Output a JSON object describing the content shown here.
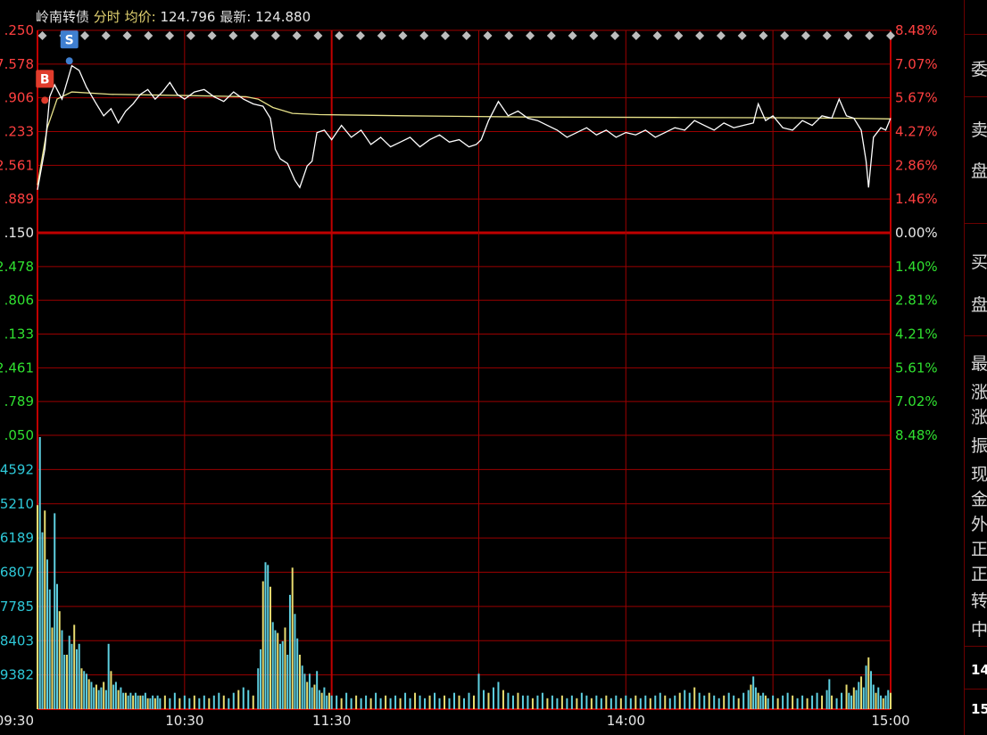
{
  "header": {
    "name": "岭南转债",
    "mode": "分时",
    "avg_label": "均价:",
    "avg_value": "124.796",
    "last_label": "最新:",
    "last_value": "124.880"
  },
  "colors": {
    "grid": "#9b0000",
    "price_line": "#ffffff",
    "avg_line": "#e8e28a",
    "up": "#ff3030",
    "down": "#30e030",
    "volume_axis": "#2ec8d8",
    "volume_bar_yellow": "#e8dc70",
    "volume_bar_cyan": "#5ecfe0"
  },
  "chart_data": {
    "type": "line",
    "left_ticks_price": [
      ".250",
      "7.578",
      ".906",
      ".233",
      "2.561",
      ".889",
      ".150",
      "2.478",
      ".806",
      ".133",
      "2.461",
      ".789",
      ".050"
    ],
    "right_ticks_pct": [
      "8.48%",
      "7.07%",
      "5.67%",
      "4.27%",
      "2.86%",
      "1.46%",
      "0.00%",
      "1.40%",
      "2.81%",
      "4.21%",
      "5.61%",
      "7.02%",
      "8.48%"
    ],
    "volume_ticks": [
      "4592",
      "5210",
      "6189",
      "6807",
      "7785",
      "8403",
      "9382"
    ],
    "time_labels": [
      "09:30",
      "10:30",
      "11:30",
      "14:00",
      "15:00"
    ],
    "y_range_pct": [
      -8.48,
      8.48
    ],
    "price_pct": [
      [
        0,
        1.8
      ],
      [
        3,
        3.5
      ],
      [
        5,
        5.7
      ],
      [
        7,
        6.2
      ],
      [
        10,
        5.6
      ],
      [
        14,
        7.0
      ],
      [
        17,
        6.8
      ],
      [
        20,
        6.1
      ],
      [
        24,
        5.4
      ],
      [
        27,
        4.9
      ],
      [
        30,
        5.2
      ],
      [
        33,
        4.6
      ],
      [
        36,
        5.1
      ],
      [
        39,
        5.4
      ],
      [
        42,
        5.8
      ],
      [
        45,
        6.0
      ],
      [
        48,
        5.6
      ],
      [
        51,
        5.9
      ],
      [
        54,
        6.3
      ],
      [
        57,
        5.8
      ],
      [
        60,
        5.6
      ],
      [
        64,
        5.9
      ],
      [
        68,
        6.0
      ],
      [
        72,
        5.7
      ],
      [
        76,
        5.5
      ],
      [
        80,
        5.9
      ],
      [
        84,
        5.6
      ],
      [
        88,
        5.4
      ],
      [
        92,
        5.3
      ],
      [
        95,
        4.8
      ],
      [
        97,
        3.5
      ],
      [
        99,
        3.1
      ],
      [
        102,
        2.9
      ],
      [
        105,
        2.2
      ],
      [
        107,
        1.9
      ],
      [
        110,
        2.8
      ],
      [
        112,
        3.0
      ],
      [
        114,
        4.2
      ],
      [
        117,
        4.3
      ],
      [
        120,
        3.9
      ],
      [
        124,
        4.5
      ],
      [
        128,
        4.0
      ],
      [
        132,
        4.3
      ],
      [
        136,
        3.7
      ],
      [
        140,
        4.0
      ],
      [
        144,
        3.6
      ],
      [
        148,
        3.8
      ],
      [
        152,
        4.0
      ],
      [
        156,
        3.6
      ],
      [
        160,
        3.9
      ],
      [
        164,
        4.1
      ],
      [
        168,
        3.8
      ],
      [
        172,
        3.9
      ],
      [
        176,
        3.6
      ],
      [
        179,
        3.7
      ],
      [
        181,
        3.9
      ],
      [
        184,
        4.7
      ],
      [
        188,
        5.5
      ],
      [
        192,
        4.9
      ],
      [
        196,
        5.1
      ],
      [
        200,
        4.8
      ],
      [
        204,
        4.7
      ],
      [
        208,
        4.5
      ],
      [
        212,
        4.3
      ],
      [
        216,
        4.0
      ],
      [
        220,
        4.2
      ],
      [
        224,
        4.4
      ],
      [
        228,
        4.1
      ],
      [
        232,
        4.3
      ],
      [
        236,
        4.0
      ],
      [
        240,
        4.2
      ],
      [
        244,
        4.1
      ],
      [
        248,
        4.3
      ],
      [
        252,
        4.0
      ],
      [
        256,
        4.2
      ],
      [
        260,
        4.4
      ],
      [
        264,
        4.3
      ],
      [
        268,
        4.7
      ],
      [
        272,
        4.5
      ],
      [
        276,
        4.3
      ],
      [
        280,
        4.6
      ],
      [
        284,
        4.4
      ],
      [
        288,
        4.5
      ],
      [
        292,
        4.6
      ],
      [
        294,
        5.4
      ],
      [
        297,
        4.7
      ],
      [
        300,
        4.9
      ],
      [
        304,
        4.4
      ],
      [
        308,
        4.3
      ],
      [
        312,
        4.7
      ],
      [
        316,
        4.5
      ],
      [
        320,
        4.9
      ],
      [
        324,
        4.8
      ],
      [
        327,
        5.6
      ],
      [
        330,
        4.9
      ],
      [
        333,
        4.8
      ],
      [
        336,
        4.3
      ],
      [
        338,
        3.0
      ],
      [
        339,
        1.9
      ],
      [
        341,
        4.0
      ],
      [
        344,
        4.4
      ],
      [
        346,
        4.3
      ],
      [
        348,
        4.8
      ]
    ],
    "avg_pct": [
      [
        0,
        2.0
      ],
      [
        4,
        4.4
      ],
      [
        8,
        5.6
      ],
      [
        14,
        5.9
      ],
      [
        30,
        5.8
      ],
      [
        60,
        5.75
      ],
      [
        85,
        5.7
      ],
      [
        90,
        5.6
      ],
      [
        96,
        5.25
      ],
      [
        104,
        5.0
      ],
      [
        115,
        4.95
      ],
      [
        150,
        4.9
      ],
      [
        200,
        4.85
      ],
      [
        260,
        4.83
      ],
      [
        300,
        4.82
      ],
      [
        330,
        4.8
      ],
      [
        348,
        4.77
      ]
    ],
    "volume": [
      [
        0,
        0.75
      ],
      [
        1,
        1.0
      ],
      [
        2,
        0.65
      ],
      [
        3,
        0.73
      ],
      [
        4,
        0.55
      ],
      [
        5,
        0.44
      ],
      [
        6,
        0.3
      ],
      [
        7,
        0.72
      ],
      [
        8,
        0.46
      ],
      [
        9,
        0.36
      ],
      [
        10,
        0.29
      ],
      [
        11,
        0.2
      ],
      [
        12,
        0.2
      ],
      [
        13,
        0.27
      ],
      [
        14,
        0.24
      ],
      [
        15,
        0.31
      ],
      [
        16,
        0.22
      ],
      [
        17,
        0.24
      ],
      [
        18,
        0.15
      ],
      [
        19,
        0.14
      ],
      [
        20,
        0.13
      ],
      [
        21,
        0.11
      ],
      [
        22,
        0.1
      ],
      [
        23,
        0.08
      ],
      [
        24,
        0.09
      ],
      [
        25,
        0.07
      ],
      [
        26,
        0.08
      ],
      [
        27,
        0.1
      ],
      [
        28,
        0.07
      ],
      [
        29,
        0.24
      ],
      [
        30,
        0.14
      ],
      [
        31,
        0.09
      ],
      [
        32,
        0.1
      ],
      [
        33,
        0.07
      ],
      [
        34,
        0.08
      ],
      [
        35,
        0.06
      ],
      [
        36,
        0.06
      ],
      [
        37,
        0.05
      ],
      [
        38,
        0.06
      ],
      [
        39,
        0.05
      ],
      [
        40,
        0.06
      ],
      [
        41,
        0.05
      ],
      [
        42,
        0.05
      ],
      [
        43,
        0.05
      ],
      [
        44,
        0.06
      ],
      [
        45,
        0.04
      ],
      [
        46,
        0.04
      ],
      [
        47,
        0.05
      ],
      [
        48,
        0.04
      ],
      [
        49,
        0.05
      ],
      [
        50,
        0.04
      ],
      [
        52,
        0.05
      ],
      [
        54,
        0.04
      ],
      [
        56,
        0.06
      ],
      [
        58,
        0.04
      ],
      [
        60,
        0.05
      ],
      [
        62,
        0.04
      ],
      [
        64,
        0.05
      ],
      [
        66,
        0.04
      ],
      [
        68,
        0.05
      ],
      [
        70,
        0.04
      ],
      [
        72,
        0.05
      ],
      [
        74,
        0.06
      ],
      [
        76,
        0.05
      ],
      [
        78,
        0.04
      ],
      [
        80,
        0.06
      ],
      [
        82,
        0.07
      ],
      [
        84,
        0.08
      ],
      [
        86,
        0.07
      ],
      [
        88,
        0.05
      ],
      [
        90,
        0.15
      ],
      [
        91,
        0.22
      ],
      [
        92,
        0.47
      ],
      [
        93,
        0.54
      ],
      [
        94,
        0.53
      ],
      [
        95,
        0.45
      ],
      [
        96,
        0.32
      ],
      [
        97,
        0.29
      ],
      [
        98,
        0.28
      ],
      [
        99,
        0.24
      ],
      [
        100,
        0.25
      ],
      [
        101,
        0.3
      ],
      [
        102,
        0.2
      ],
      [
        103,
        0.42
      ],
      [
        104,
        0.52
      ],
      [
        105,
        0.35
      ],
      [
        106,
        0.26
      ],
      [
        107,
        0.2
      ],
      [
        108,
        0.16
      ],
      [
        109,
        0.13
      ],
      [
        110,
        0.1
      ],
      [
        111,
        0.13
      ],
      [
        112,
        0.08
      ],
      [
        113,
        0.09
      ],
      [
        114,
        0.14
      ],
      [
        115,
        0.07
      ],
      [
        116,
        0.06
      ],
      [
        117,
        0.08
      ],
      [
        118,
        0.05
      ],
      [
        119,
        0.06
      ],
      [
        120,
        0.05
      ],
      [
        122,
        0.05
      ],
      [
        124,
        0.04
      ],
      [
        126,
        0.06
      ],
      [
        128,
        0.04
      ],
      [
        130,
        0.05
      ],
      [
        132,
        0.04
      ],
      [
        134,
        0.05
      ],
      [
        136,
        0.04
      ],
      [
        138,
        0.06
      ],
      [
        140,
        0.04
      ],
      [
        142,
        0.05
      ],
      [
        144,
        0.04
      ],
      [
        146,
        0.05
      ],
      [
        148,
        0.04
      ],
      [
        150,
        0.06
      ],
      [
        152,
        0.04
      ],
      [
        154,
        0.06
      ],
      [
        156,
        0.05
      ],
      [
        158,
        0.04
      ],
      [
        160,
        0.05
      ],
      [
        162,
        0.06
      ],
      [
        164,
        0.04
      ],
      [
        166,
        0.05
      ],
      [
        168,
        0.04
      ],
      [
        170,
        0.06
      ],
      [
        172,
        0.05
      ],
      [
        174,
        0.04
      ],
      [
        176,
        0.06
      ],
      [
        178,
        0.05
      ],
      [
        180,
        0.13
      ],
      [
        182,
        0.07
      ],
      [
        184,
        0.06
      ],
      [
        186,
        0.08
      ],
      [
        188,
        0.1
      ],
      [
        190,
        0.07
      ],
      [
        192,
        0.06
      ],
      [
        194,
        0.05
      ],
      [
        196,
        0.06
      ],
      [
        198,
        0.05
      ],
      [
        200,
        0.05
      ],
      [
        202,
        0.04
      ],
      [
        204,
        0.05
      ],
      [
        206,
        0.06
      ],
      [
        208,
        0.04
      ],
      [
        210,
        0.05
      ],
      [
        212,
        0.04
      ],
      [
        214,
        0.05
      ],
      [
        216,
        0.04
      ],
      [
        218,
        0.05
      ],
      [
        220,
        0.04
      ],
      [
        222,
        0.06
      ],
      [
        224,
        0.05
      ],
      [
        226,
        0.04
      ],
      [
        228,
        0.05
      ],
      [
        230,
        0.04
      ],
      [
        232,
        0.05
      ],
      [
        234,
        0.04
      ],
      [
        236,
        0.05
      ],
      [
        238,
        0.04
      ],
      [
        240,
        0.05
      ],
      [
        242,
        0.04
      ],
      [
        244,
        0.05
      ],
      [
        246,
        0.04
      ],
      [
        248,
        0.05
      ],
      [
        250,
        0.04
      ],
      [
        252,
        0.05
      ],
      [
        254,
        0.06
      ],
      [
        256,
        0.05
      ],
      [
        258,
        0.04
      ],
      [
        260,
        0.05
      ],
      [
        262,
        0.06
      ],
      [
        264,
        0.07
      ],
      [
        266,
        0.06
      ],
      [
        268,
        0.08
      ],
      [
        270,
        0.06
      ],
      [
        272,
        0.05
      ],
      [
        274,
        0.06
      ],
      [
        276,
        0.05
      ],
      [
        278,
        0.04
      ],
      [
        280,
        0.05
      ],
      [
        282,
        0.06
      ],
      [
        284,
        0.05
      ],
      [
        286,
        0.04
      ],
      [
        288,
        0.06
      ],
      [
        290,
        0.07
      ],
      [
        291,
        0.09
      ],
      [
        292,
        0.12
      ],
      [
        293,
        0.08
      ],
      [
        294,
        0.06
      ],
      [
        295,
        0.05
      ],
      [
        296,
        0.06
      ],
      [
        297,
        0.05
      ],
      [
        298,
        0.04
      ],
      [
        300,
        0.05
      ],
      [
        302,
        0.04
      ],
      [
        304,
        0.05
      ],
      [
        306,
        0.06
      ],
      [
        308,
        0.05
      ],
      [
        310,
        0.04
      ],
      [
        312,
        0.05
      ],
      [
        314,
        0.04
      ],
      [
        316,
        0.05
      ],
      [
        318,
        0.06
      ],
      [
        320,
        0.05
      ],
      [
        322,
        0.07
      ],
      [
        323,
        0.11
      ],
      [
        324,
        0.05
      ],
      [
        326,
        0.04
      ],
      [
        328,
        0.06
      ],
      [
        330,
        0.09
      ],
      [
        331,
        0.06
      ],
      [
        332,
        0.05
      ],
      [
        333,
        0.08
      ],
      [
        334,
        0.07
      ],
      [
        335,
        0.1
      ],
      [
        336,
        0.12
      ],
      [
        337,
        0.08
      ],
      [
        338,
        0.16
      ],
      [
        339,
        0.19
      ],
      [
        340,
        0.14
      ],
      [
        341,
        0.09
      ],
      [
        342,
        0.06
      ],
      [
        343,
        0.08
      ],
      [
        344,
        0.05
      ],
      [
        345,
        0.04
      ],
      [
        346,
        0.05
      ],
      [
        347,
        0.07
      ],
      [
        348,
        0.06
      ]
    ],
    "markers": [
      {
        "label": "B",
        "x": 3,
        "pct": 5.7
      },
      {
        "label": "S",
        "x": 13,
        "pct": 7.2
      }
    ],
    "diamonds_count": 41
  },
  "side_panel": {
    "chars": [
      "委",
      "卖",
      "盘",
      "买",
      "盘",
      "最",
      "涨",
      "涨",
      "振",
      "现",
      "金",
      "外",
      "正",
      "正",
      "转",
      "中"
    ],
    "nums": [
      "14",
      "15"
    ]
  }
}
